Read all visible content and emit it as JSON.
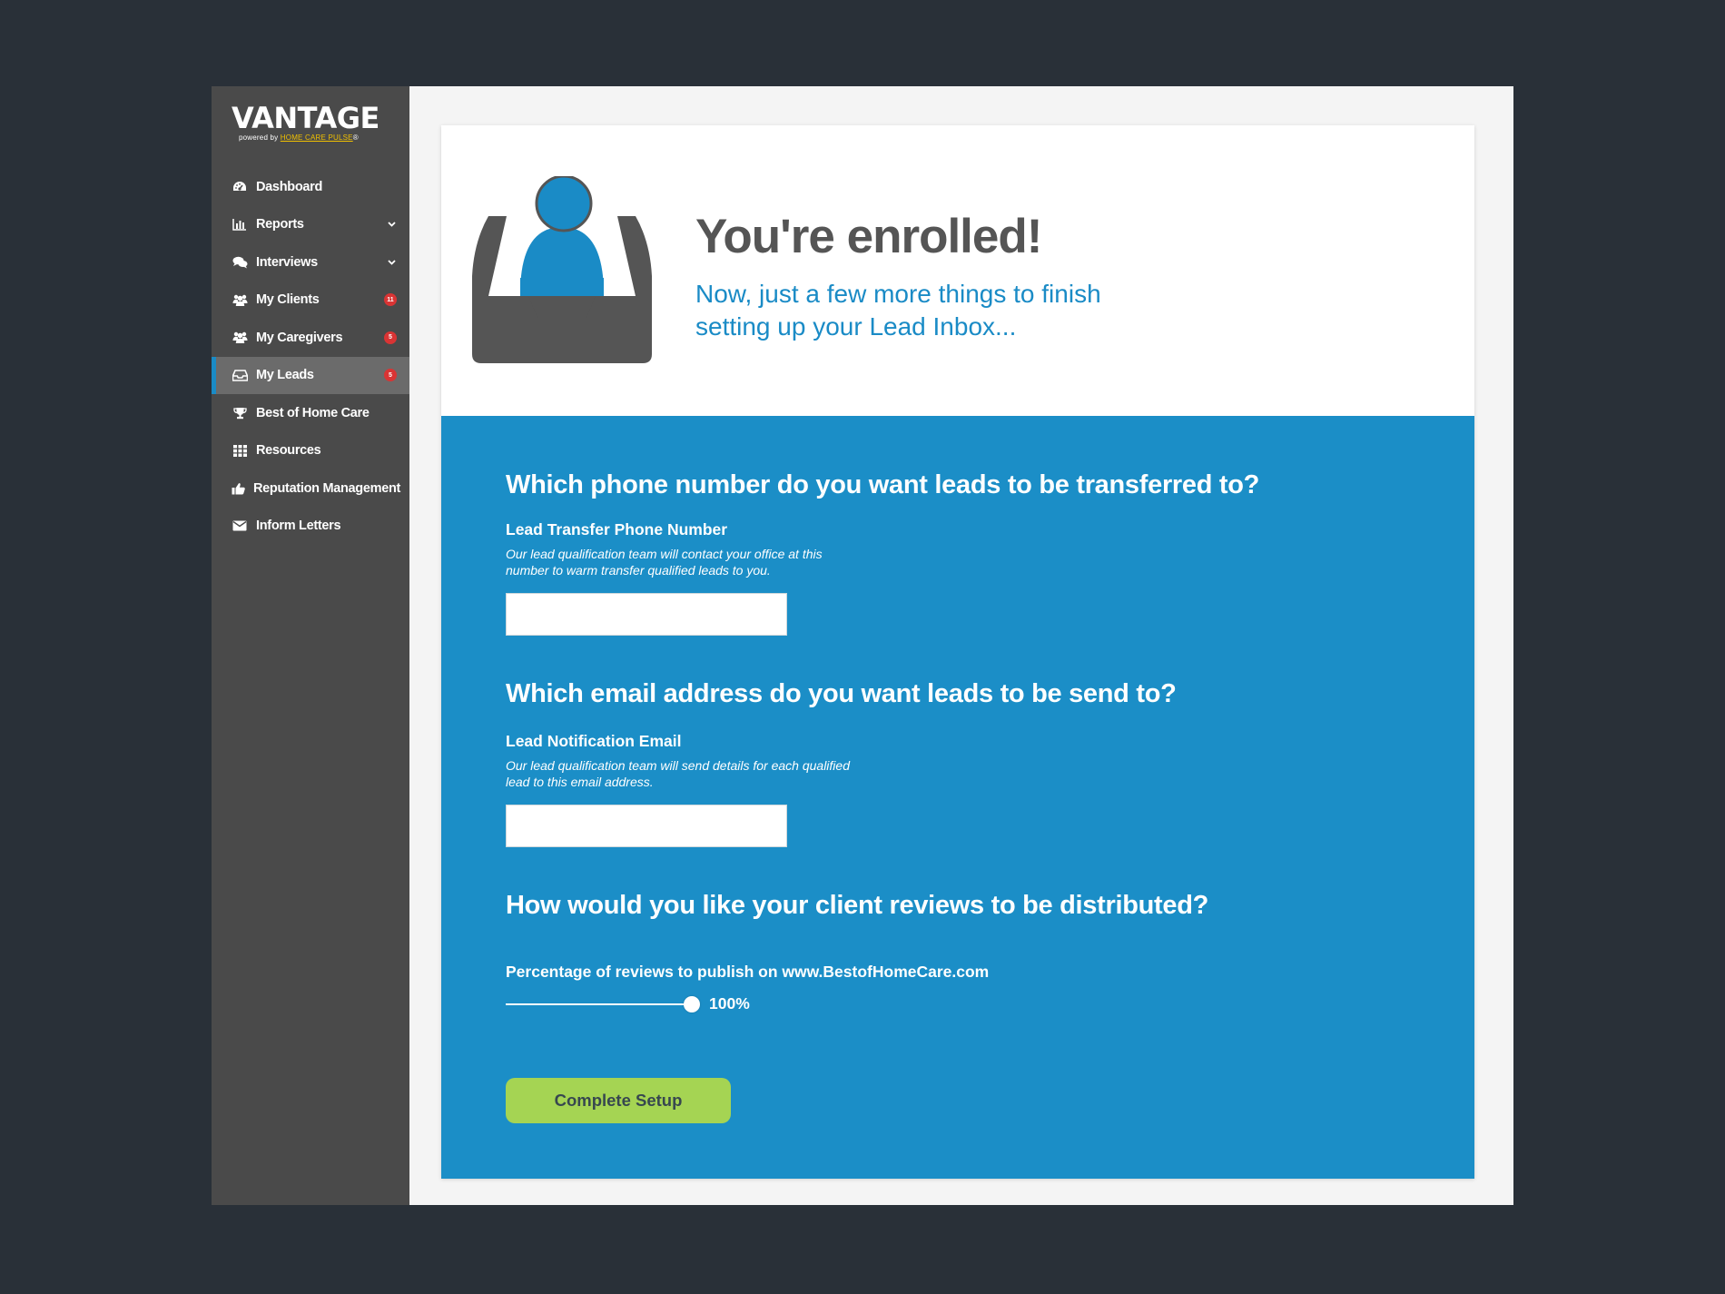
{
  "brand": {
    "name": "VANTAGE",
    "powered_prefix": "powered by",
    "powered_brand": "HOME CARE PULSE",
    "powered_mark": "®"
  },
  "sidebar": {
    "items": [
      {
        "label": "Dashboard",
        "icon": "dashboard-icon"
      },
      {
        "label": "Reports",
        "icon": "bar-chart-icon",
        "has_submenu": true
      },
      {
        "label": "Interviews",
        "icon": "chat-bubbles-icon",
        "has_submenu": true
      },
      {
        "label": "My Clients",
        "icon": "users-icon",
        "badge": "11"
      },
      {
        "label": "My Caregivers",
        "icon": "users-icon",
        "badge": "5"
      },
      {
        "label": "My Leads",
        "icon": "inbox-icon",
        "badge": "5",
        "active": true
      },
      {
        "label": "Best of Home Care",
        "icon": "trophy-icon"
      },
      {
        "label": "Resources",
        "icon": "grid-icon"
      },
      {
        "label": "Reputation Management",
        "icon": "thumbs-up-icon"
      },
      {
        "label": "Inform Letters",
        "icon": "envelope-icon"
      }
    ]
  },
  "hero": {
    "title": "You're enrolled!",
    "subtitle": "Now, just a few more things to finish setting up your Lead Inbox..."
  },
  "form": {
    "phone": {
      "question": "Which phone number do you want leads to be transferred to?",
      "label": "Lead Transfer Phone Number",
      "help": "Our lead qualification team will contact your office at this number to warm transfer qualified leads to you.",
      "value": "",
      "placeholder": ""
    },
    "email": {
      "question": "Which email address do you want leads to be send to?",
      "label": "Lead Notification Email",
      "help": "Our lead qualification team will send details for each qualified lead to this email address.",
      "value": "",
      "placeholder": ""
    },
    "reviews": {
      "question": "How would you like your client reviews to be distributed?",
      "label": "Percentage of reviews to publish on www.BestofHomeCare.com",
      "percent": 100,
      "value_text": "100%"
    },
    "submit_label": "Complete Setup"
  },
  "colors": {
    "accent": "#1a8bc6",
    "form_bg": "#1b8ec7",
    "sidebar_bg": "#4a4a4a",
    "button_bg": "#a5d453",
    "badge": "#d93434"
  }
}
